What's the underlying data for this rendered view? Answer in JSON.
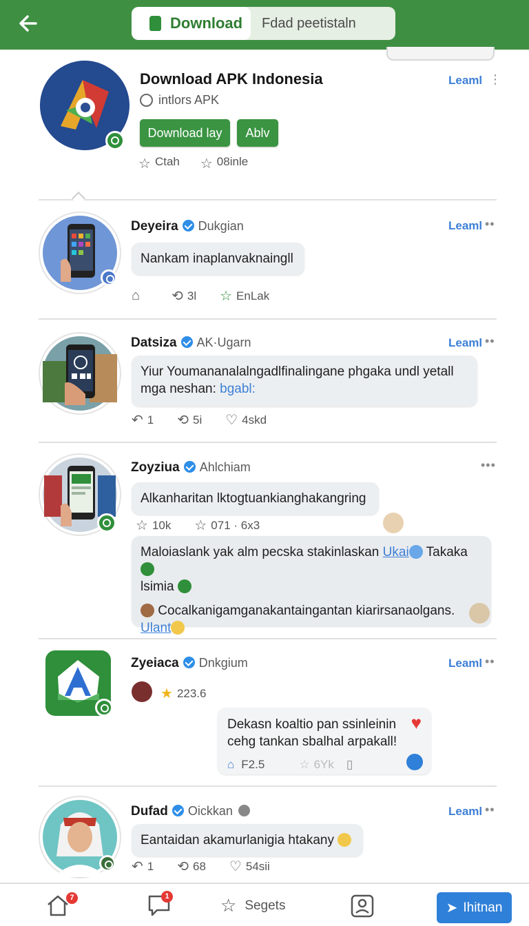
{
  "topbar": {
    "tab_download": "Download",
    "tab_other": "Fdad peetistaln"
  },
  "app": {
    "title": "Download APK Indonesia",
    "subtitle": "intlors  APK",
    "btn_primary": "Download lay",
    "btn_secondary": "Ablv",
    "stat1": "Ctah",
    "stat2": "08inle",
    "learn": "Leaml"
  },
  "posts": [
    {
      "name": "Deyeira",
      "handle": "Dukgian",
      "learn": "Leaml",
      "text": "Nankam inaplanvaknaingll",
      "actions": [
        "",
        "3l",
        "EnLak"
      ]
    },
    {
      "name": "Datsiza",
      "handle": "AK·Ugarn",
      "learn": "Leaml",
      "text": "Yiur Youmananalalngadlfinalingane phgaka undl yetall mga neshan:",
      "link": "bgabl:",
      "actions": [
        "1",
        "5i",
        "4skd"
      ]
    },
    {
      "name": "Zoyziua",
      "handle": "Ahlchiam",
      "text": "Alkanharitan lktogtuankianghakangring",
      "actions": [
        "10k",
        "071 · 6x3"
      ],
      "quote_line1": "Maloiaslank yak alm pecska stakinlaskan",
      "quote_link1": "Ukai",
      "quote_word1": "Takaka",
      "quote_line2": "lsimia",
      "quote_line3": "Cocalkanigamganakantaingantan kiarirsanaolgans.",
      "quote_link2": "Ulant"
    },
    {
      "name": "Zyeiaca",
      "handle": "Dnkgium",
      "learn": "Leaml",
      "rating": "223.6",
      "reply_text": "Dekasn koaltio pan ssinleinin cehg tankan sbalhal arpakall!",
      "reply_stat": "F2.5",
      "reply_stat2": "6Yk"
    },
    {
      "name": "Dufad",
      "handle": "Oickkan",
      "learn": "Leaml",
      "text": "Eantaidan akamurlanigia htakany",
      "actions": [
        "1",
        "68",
        "54sii"
      ]
    }
  ],
  "nav": {
    "home_badge": "7",
    "msg_badge": "1",
    "center_label": "Segets",
    "post_label": "Ihitnan"
  },
  "colors": {
    "brand_green": "#3f8f43",
    "link_blue": "#3d7fd6",
    "verified": "#2e8ee8"
  }
}
